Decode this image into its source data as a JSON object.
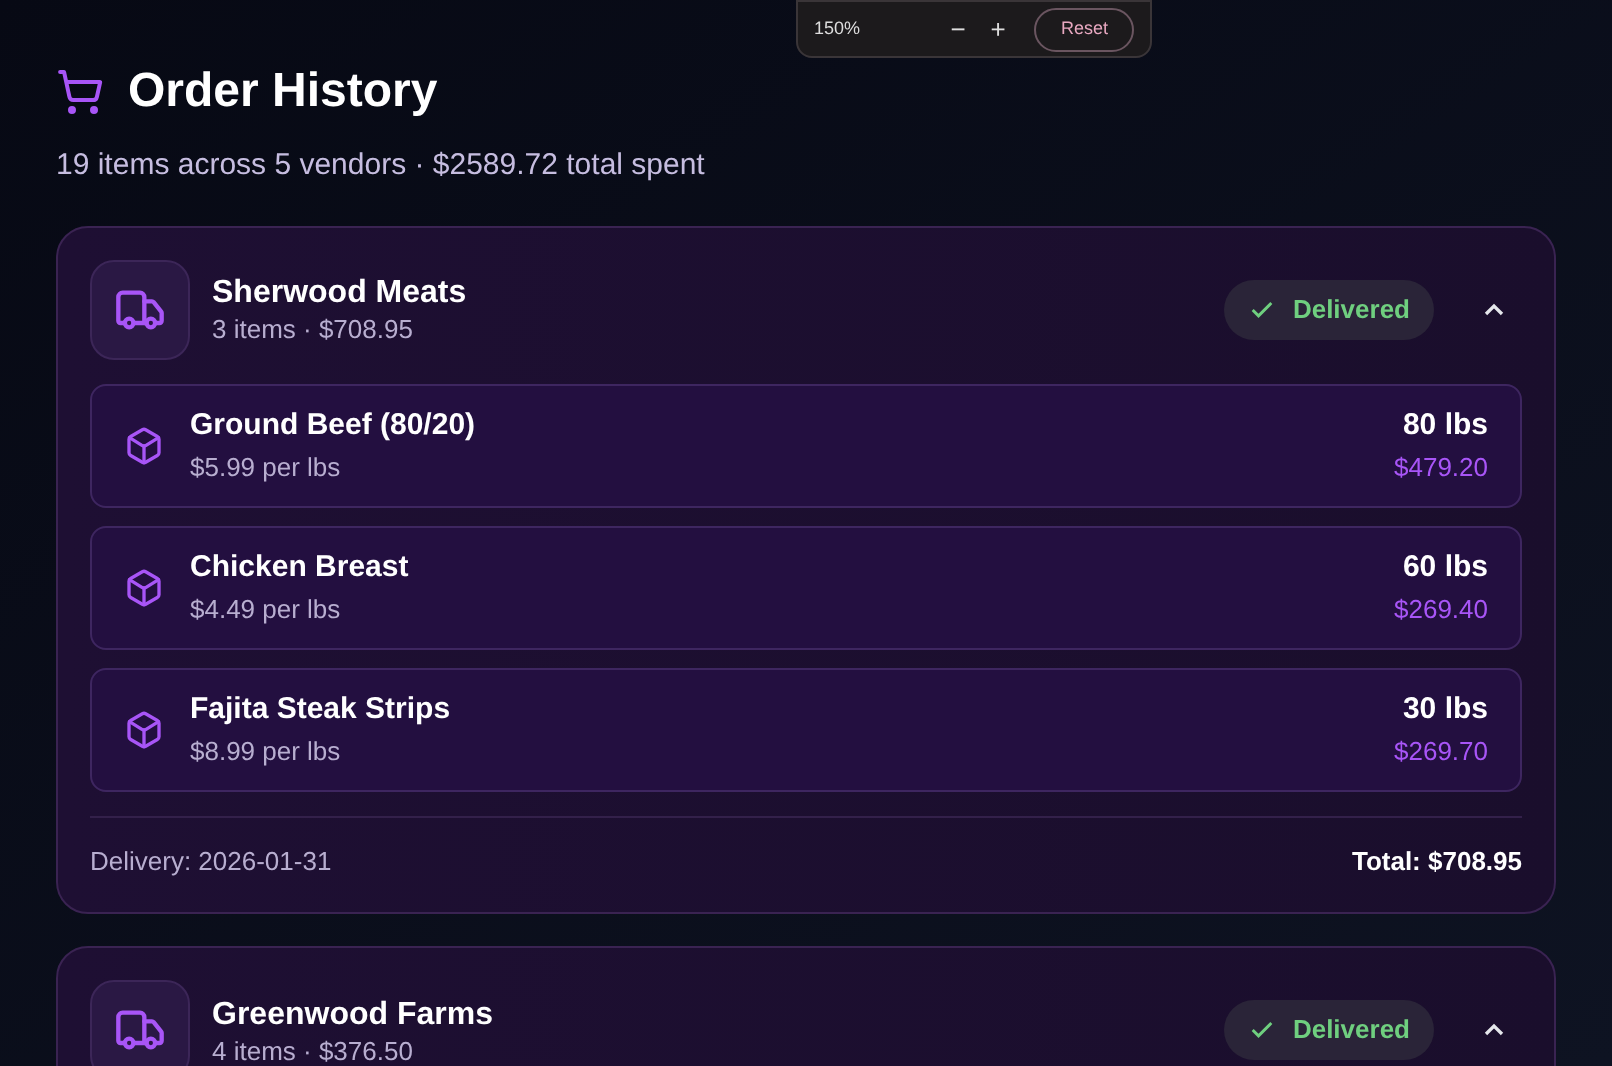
{
  "zoom_bar": {
    "zoom": "150%",
    "decrease": "−",
    "increase": "+",
    "reset": "Reset"
  },
  "header": {
    "title": "Order History",
    "summary": "19 items across 5 vendors · $2589.72 total spent"
  },
  "vendors": [
    {
      "name": "Sherwood Meats",
      "subtitle": "3 items · $708.95",
      "status": "Delivered",
      "expanded": true,
      "items": [
        {
          "name": "Ground Beef (80/20)",
          "unit_price": "$5.99 per lbs",
          "quantity": "80 lbs",
          "total": "$479.20"
        },
        {
          "name": "Chicken Breast",
          "unit_price": "$4.49 per lbs",
          "quantity": "60 lbs",
          "total": "$269.40"
        },
        {
          "name": "Fajita Steak Strips",
          "unit_price": "$8.99 per lbs",
          "quantity": "30 lbs",
          "total": "$269.70"
        }
      ],
      "delivery": "Delivery: 2026-01-31",
      "total": "Total: $708.95"
    },
    {
      "name": "Greenwood Farms",
      "subtitle": "4 items · $376.50",
      "status": "Delivered",
      "expanded": true
    }
  ]
}
